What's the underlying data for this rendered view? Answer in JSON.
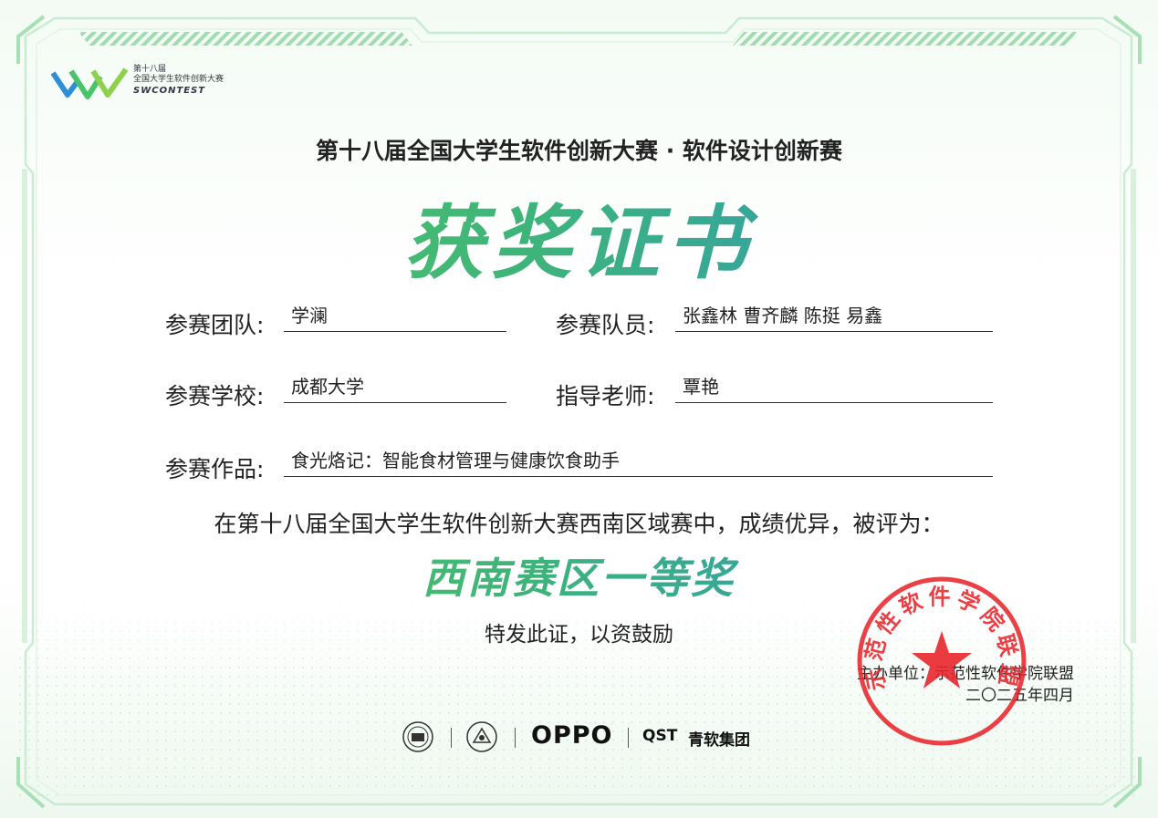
{
  "logo": {
    "line1": "第十八届",
    "line2": "全国大学生软件创新大赛",
    "line3": "SWCONTEST"
  },
  "header": {
    "subtitle": "第十八届全国大学生软件创新大赛 · 软件设计创新赛",
    "title": "获奖证书"
  },
  "fields": {
    "team_label": "参赛团队:",
    "team_value": "学澜",
    "members_label": "参赛队员:",
    "members_value": "张鑫林  曹齐麟  陈挺  易鑫",
    "school_label": "参赛学校:",
    "school_value": "成都大学",
    "advisor_label": "指导老师:",
    "advisor_value": "覃艳",
    "work_label": "参赛作品:",
    "work_value": "食光烙记：智能食材管理与健康饮食助手"
  },
  "statement": "在第十八届全国大学生软件创新大赛西南区域赛中，成绩优异，被评为：",
  "award": "西南赛区一等奖",
  "closing": "特发此证，以资鼓励",
  "organizer": "主办单位：示范性软件学院联盟",
  "date": "二〇二五年四月",
  "seal": {
    "text": "示范性软件学院联盟",
    "color": "#e8262c"
  },
  "sponsors": {
    "oppo": "OPPO",
    "qst": "QST",
    "qst_cn": "青软集团"
  },
  "colors": {
    "accent_green": "#5fcf5a",
    "accent_blue": "#2a8fd0",
    "frame_green": "#bfe8c4"
  }
}
